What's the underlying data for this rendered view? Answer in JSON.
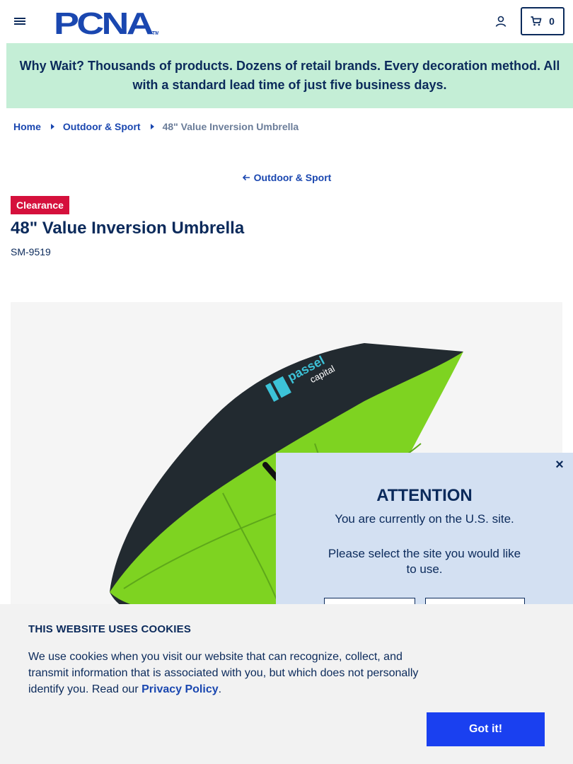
{
  "header": {
    "logo_text": "PCNA",
    "logo_trademark": "TM",
    "cart_count": "0"
  },
  "promo": {
    "text": "Why Wait? Thousands of products. Dozens of retail brands. Every decoration method. All with a standard lead time of just five business days."
  },
  "breadcrumb": {
    "items": [
      {
        "label": "Home"
      },
      {
        "label": "Outdoor & Sport"
      },
      {
        "label": "48\" Value Inversion Umbrella"
      }
    ]
  },
  "back_link": {
    "label": "Outdoor & Sport"
  },
  "product": {
    "badge": "Clearance",
    "title": "48\" Value Inversion Umbrella",
    "sku": "SM-9519",
    "image_brand_text": "passel",
    "image_brand_subtext": "capital"
  },
  "attention": {
    "close_label": "×",
    "title": "ATTENTION",
    "message": "You are currently on the U.S. site.",
    "prompt": "Please select the site you would like to use.",
    "option_1": "",
    "option_2": ""
  },
  "cookies": {
    "title": "THIS WEBSITE USES COOKIES",
    "text_before_link": "We use cookies when you visit our website that can recognize, collect, and transmit information that is associated with you, but which does not personally identify you. Read our ",
    "link_label": "Privacy Policy",
    "text_after_link": ".",
    "button_label": "Got it!"
  },
  "colors": {
    "navy": "#0b2a5b",
    "link_blue": "#1a47b0",
    "promo_bg": "#c4eed6",
    "clearance_red": "#d5103c",
    "modal_bg": "#d3e0f2",
    "cookie_bg": "#f2f2f2",
    "cookie_button": "#1a40f0",
    "umbrella_black": "#222a30",
    "umbrella_green": "#7ed321"
  },
  "icons": {
    "menu": "hamburger-icon",
    "account": "user-icon",
    "cart": "cart-icon",
    "back": "arrow-left-icon",
    "breadcrumb_separator": "caret-right-icon",
    "close": "close-icon"
  }
}
